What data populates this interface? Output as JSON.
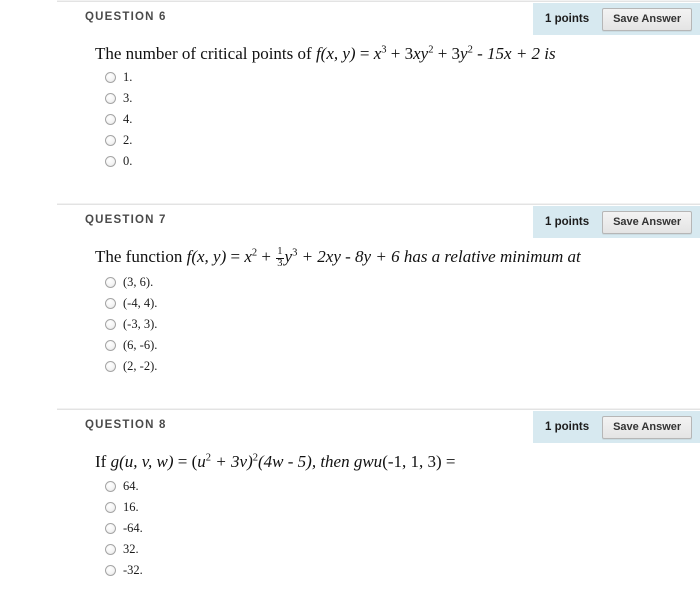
{
  "questions": [
    {
      "heading": "QUESTION 6",
      "points": "1 points",
      "save_label": "Save Answer",
      "text_parts": {
        "lead": "The number of critical points of ",
        "fn": "f",
        "args": "(x, y)",
        "eq": " = ",
        "base1": "x",
        "exp1": "3",
        "op1": " + 3",
        "base2": "xy",
        "exp2": "2",
        "op2": " + 3",
        "base3": "y",
        "exp3": "2",
        "tail": " - 15x + 2 is"
      },
      "options": [
        "1.",
        "3.",
        "4.",
        "2.",
        "0."
      ]
    },
    {
      "heading": "QUESTION 7",
      "points": "1 points",
      "save_label": "Save Answer",
      "text_parts": {
        "lead": "The function ",
        "fn": "f",
        "args": "(x, y)",
        "eq": " = ",
        "base1": "x",
        "exp1": "2",
        "op1": " + ",
        "frac_num": "1",
        "frac_den": "3",
        "base2": "y",
        "exp2": "3",
        "tail": " + 2xy - 8y + 6 has a relative minimum at"
      },
      "options": [
        "(3, 6).",
        "(-4, 4).",
        "(-3, 3).",
        "(6, -6).",
        "(2, -2)."
      ]
    },
    {
      "heading": "QUESTION 8",
      "points": "1 points",
      "save_label": "Save Answer",
      "text_parts": {
        "lead": "If ",
        "fn": "g",
        "args": "(u, v, w)",
        "eq": " = (",
        "base1": "u",
        "exp1": "2",
        "op1": " + 3v)",
        "exp2": "2",
        "mid": "(4w - 5), then ",
        "fn2": "gwu",
        "tail": "(-1, 1, 3) ="
      },
      "options": [
        "64.",
        "16.",
        "-64.",
        "32.",
        "-32."
      ]
    }
  ],
  "colors": {
    "header_panel": "#d7e9f0",
    "divider": "#e3e3e3",
    "text": "#111111",
    "heading": "#4a4a4a"
  }
}
